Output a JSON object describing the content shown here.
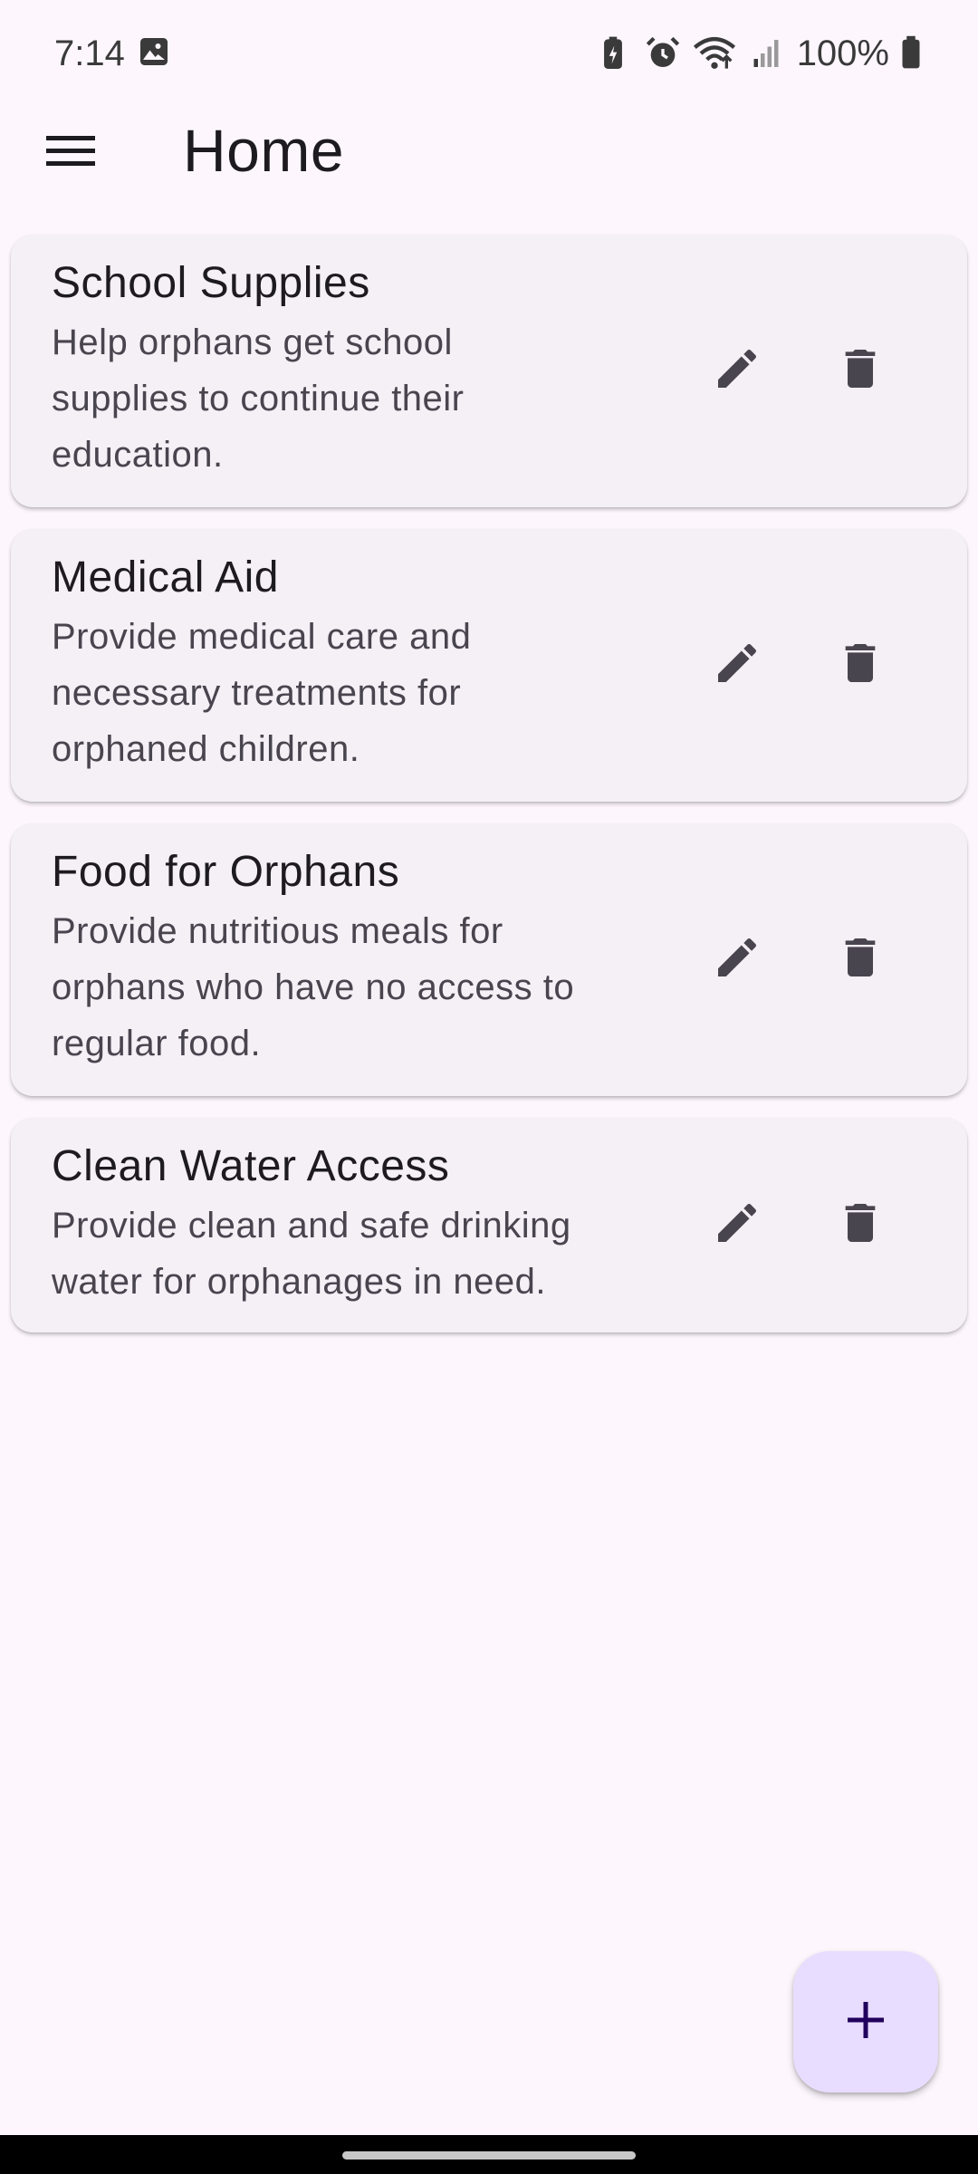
{
  "status_bar": {
    "time": "7:14",
    "battery": "100%",
    "icons": [
      "image-icon",
      "battery-saver-icon",
      "alarm-icon",
      "wifi-icon",
      "signal-icon",
      "battery-icon"
    ]
  },
  "app_bar": {
    "title": "Home",
    "menu_icon": "menu-icon"
  },
  "cards": [
    {
      "title": "School Supplies",
      "description": "Help orphans get school supplies to continue their education.",
      "desc_lines": [
        "Help orphans get school",
        "supplies to continue their",
        "education."
      ]
    },
    {
      "title": "Medical Aid",
      "description": "Provide medical care and necessary treatments for orphaned children.",
      "desc_lines": [
        "Provide medical care and",
        "necessary treatments for",
        "orphaned children."
      ]
    },
    {
      "title": "Food for Orphans",
      "description": "Provide nutritious meals for orphans who have no access to regular food.",
      "desc_lines": [
        "Provide nutritious meals for",
        "orphans who have no access to",
        "regular food."
      ]
    },
    {
      "title": "Clean Water Access",
      "description": "Provide clean and safe drinking water for orphanages in need.",
      "desc_lines": [
        "Provide clean and safe drinking",
        "water for orphanages in need."
      ]
    }
  ],
  "fab": {
    "icon": "add-icon"
  },
  "colors": {
    "background": "#fdf7fd",
    "card": "#f5eff6",
    "fab": "#e9ddff",
    "icon": "#49454f",
    "title": "#1d1b20"
  }
}
